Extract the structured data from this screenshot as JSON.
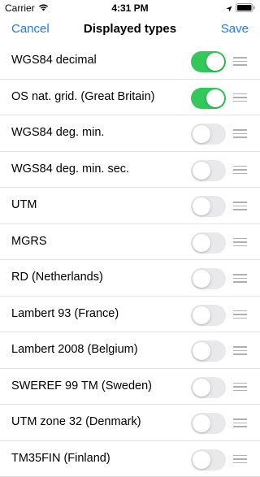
{
  "status_bar": {
    "carrier": "Carrier",
    "time": "4:31 PM"
  },
  "nav": {
    "cancel_label": "Cancel",
    "title": "Displayed types",
    "save_label": "Save"
  },
  "colors": {
    "accent": "#1a7cf5",
    "toggle_on": "#34c759",
    "toggle_off": "#e9e9eb"
  },
  "items": [
    {
      "label": "WGS84 decimal",
      "enabled": true
    },
    {
      "label": "OS nat. grid. (Great Britain)",
      "enabled": true
    },
    {
      "label": "WGS84 deg. min.",
      "enabled": false
    },
    {
      "label": "WGS84 deg. min. sec.",
      "enabled": false
    },
    {
      "label": "UTM",
      "enabled": false
    },
    {
      "label": "MGRS",
      "enabled": false
    },
    {
      "label": "RD (Netherlands)",
      "enabled": false
    },
    {
      "label": "Lambert 93 (France)",
      "enabled": false
    },
    {
      "label": "Lambert 2008 (Belgium)",
      "enabled": false
    },
    {
      "label": "SWEREF 99 TM (Sweden)",
      "enabled": false
    },
    {
      "label": "UTM zone 32 (Denmark)",
      "enabled": false
    },
    {
      "label": "TM35FIN (Finland)",
      "enabled": false
    }
  ]
}
